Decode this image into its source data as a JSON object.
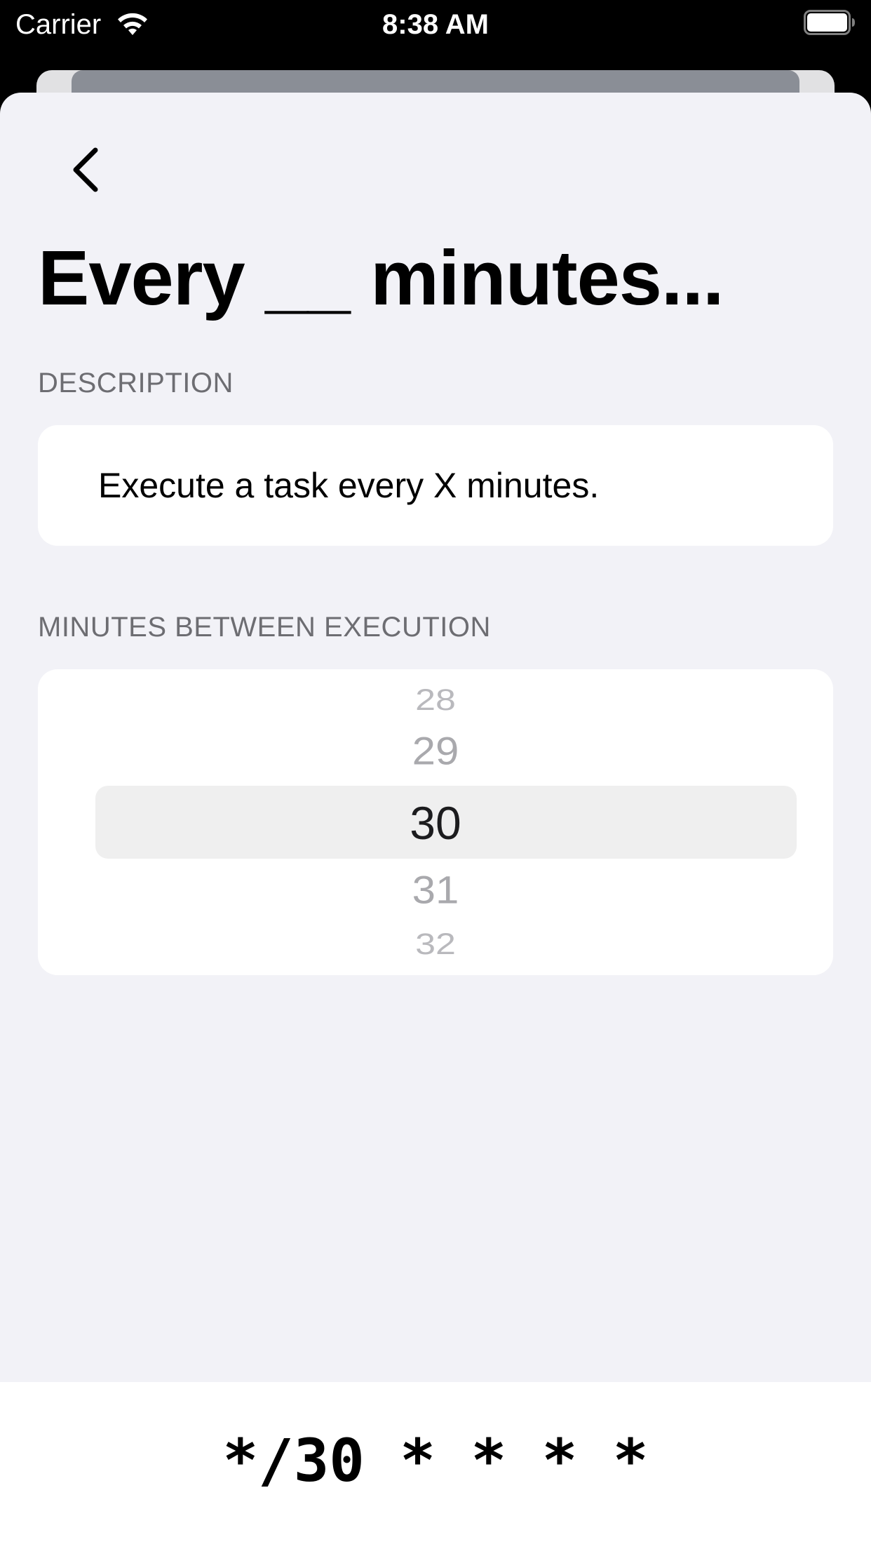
{
  "status_bar": {
    "carrier": "Carrier",
    "time": "8:38 AM",
    "wifi_icon": "wifi-icon",
    "battery_icon": "battery-icon"
  },
  "navigation": {
    "back_icon": "chevron-left-icon"
  },
  "page": {
    "title": "Every __ minutes..."
  },
  "description_section": {
    "header": "DESCRIPTION",
    "text": "Execute a task every X minutes."
  },
  "minutes_section": {
    "header": "MINUTES BETWEEN EXECUTION",
    "picker": {
      "options": [
        "28",
        "29",
        "30",
        "31",
        "32"
      ],
      "selected": "30"
    }
  },
  "cron": {
    "expression": "*/30 * * * *"
  },
  "colors": {
    "background": "#f2f2f7",
    "card": "#ffffff",
    "section_header": "#6d6d72",
    "picker_highlight": "#efefef"
  }
}
